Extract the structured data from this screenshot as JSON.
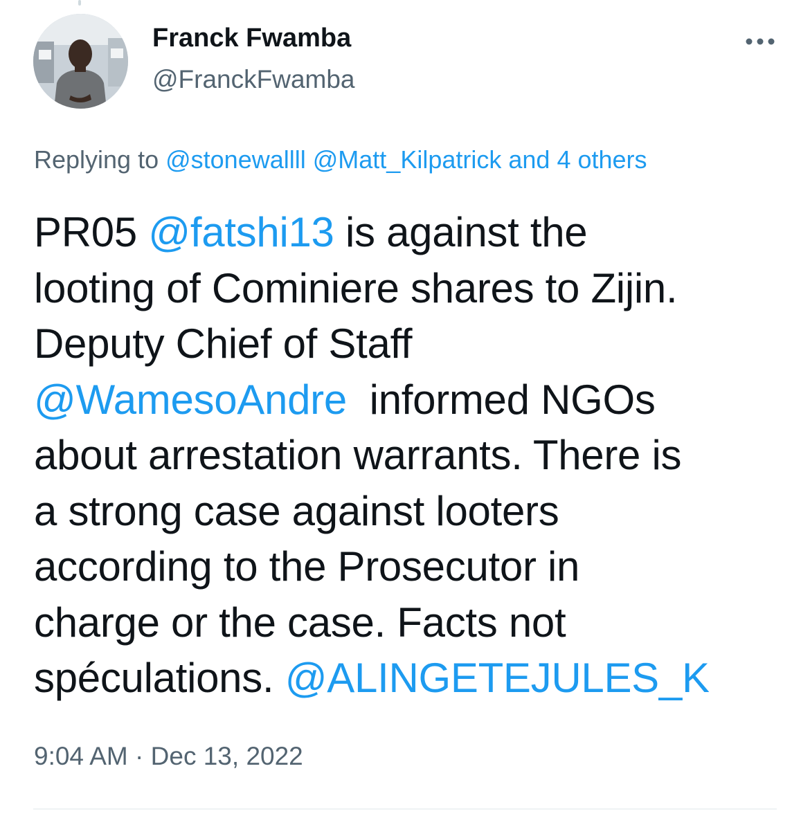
{
  "author": {
    "display_name": "Franck Fwamba",
    "handle": "@FranckFwamba"
  },
  "more_menu": {
    "icon": "more-horizontal-icon"
  },
  "reply_context": {
    "prefix": "Replying to ",
    "mention_1": "@stonewallll",
    "mention_2": "@Matt_Kilpatrick",
    "others": "and 4 others"
  },
  "tweet": {
    "segments": [
      {
        "text": "PR05 ",
        "mention": false
      },
      {
        "text": "@fatshi13",
        "mention": true
      },
      {
        "text": " is against the\nlooting of Cominiere shares to Zijin.\nDeputy Chief of Staff\n",
        "mention": false
      },
      {
        "text": "@WamesoAndre",
        "mention": true
      },
      {
        "text": "  informed NGOs\nabout arrestation warrants. There is\na strong case against looters\naccording to the Prosecutor in\ncharge or the case. Facts not\nspéculations. ",
        "mention": false
      },
      {
        "text": "@ALINGETEJULES_K",
        "mention": true
      }
    ]
  },
  "meta": {
    "time": "9:04 AM",
    "separator": " · ",
    "date": "Dec 13, 2022"
  },
  "colors": {
    "link": "#1d9bf0",
    "secondary_text": "#536471",
    "primary_text": "#0f1419",
    "divider": "#eff3f4"
  }
}
